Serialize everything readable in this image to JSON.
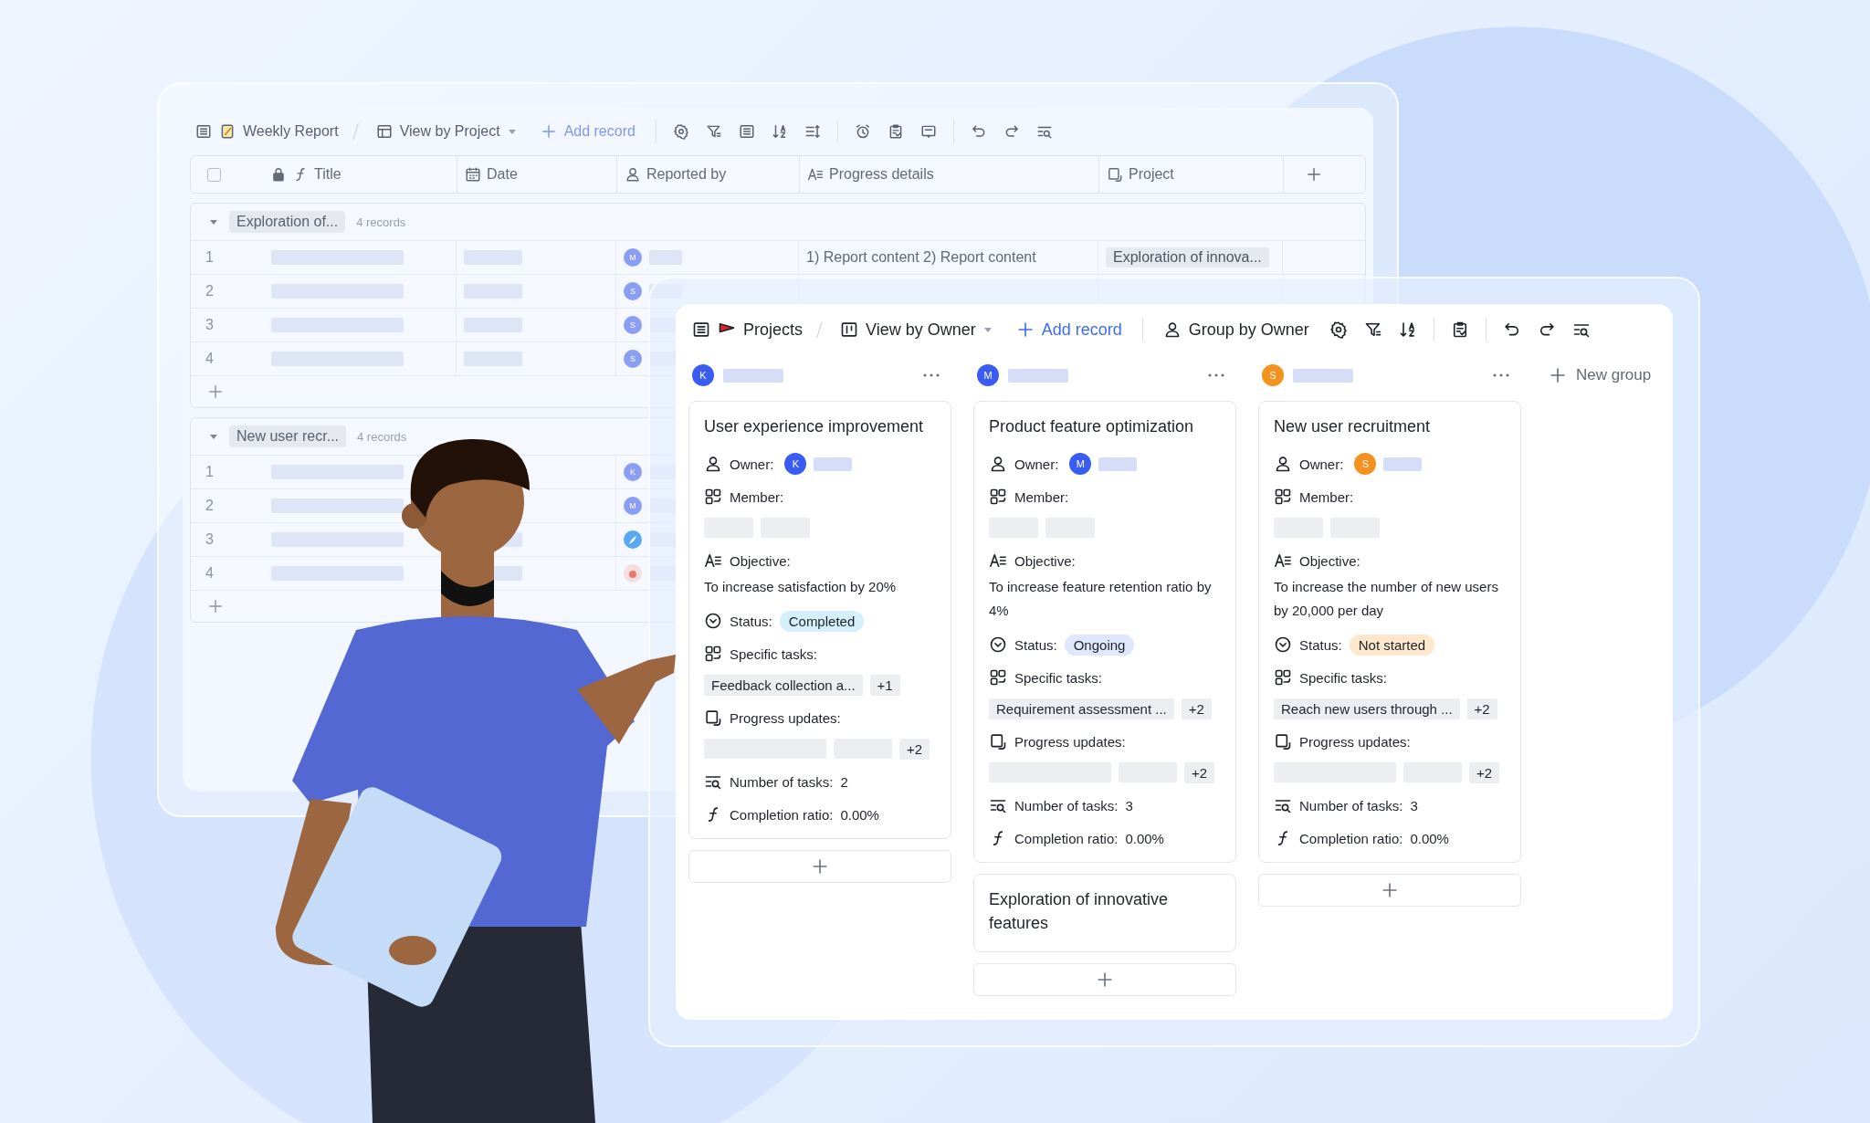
{
  "back_window": {
    "toolbar": {
      "title": "Weekly Report",
      "view": "View by Project",
      "add_record": "Add record"
    },
    "select_all": {
      "checked": false
    },
    "columns": [
      {
        "kind": "formula",
        "label": "Title"
      },
      {
        "kind": "date",
        "label": "Date"
      },
      {
        "kind": "person",
        "label": "Reported by"
      },
      {
        "kind": "text",
        "label": "Progress details"
      },
      {
        "kind": "link",
        "label": "Project"
      }
    ],
    "groups": [
      {
        "label": "Exploration of...",
        "count": "4 records",
        "expanded": true,
        "rows": [
          {
            "number": "1",
            "avatar": {
              "kind": "letter",
              "text": "M"
            },
            "progress": "1) Report content 2) Report content",
            "project": "Exploration of innova..."
          },
          {
            "number": "2",
            "avatar": {
              "kind": "letter",
              "text": "S"
            }
          },
          {
            "number": "3",
            "avatar": {
              "kind": "letter",
              "text": "S"
            }
          },
          {
            "number": "4",
            "avatar": {
              "kind": "letter",
              "text": "S"
            }
          }
        ]
      },
      {
        "label": "New user recr...",
        "count": "4 records",
        "expanded": true,
        "rows": [
          {
            "number": "1",
            "avatar": {
              "kind": "letter",
              "text": "K"
            }
          },
          {
            "number": "2",
            "avatar": {
              "kind": "letter",
              "text": "M"
            }
          },
          {
            "number": "3",
            "avatar": {
              "kind": "feather"
            }
          },
          {
            "number": "4",
            "avatar": {
              "kind": "fruit"
            }
          }
        ]
      }
    ]
  },
  "front_window": {
    "toolbar": {
      "title": "Projects",
      "view": "View by Owner",
      "add_record": "Add record",
      "group_by": "Group by Owner"
    },
    "columns": [
      {
        "avatar": "K",
        "color": "#3b5cf2",
        "cards": [
          {
            "title": "User experience improvement",
            "fields": [
              {
                "kind": "owner",
                "label": "Owner:",
                "avatar": "K",
                "color": "#3b5cf2"
              },
              {
                "kind": "member",
                "label": "Member:"
              },
              {
                "kind": "objective",
                "label": "Objective:",
                "value": "To increase satisfaction by 20%"
              },
              {
                "kind": "status",
                "label": "Status:",
                "value": "Completed",
                "color": "#d5f0fb"
              },
              {
                "kind": "tasks",
                "label": "Specific tasks:",
                "value": "Feedback collection a...",
                "more": "+1"
              },
              {
                "kind": "progress",
                "label": "Progress updates:",
                "more": "+2"
              },
              {
                "kind": "count",
                "label": "Number of tasks:",
                "value": "2"
              },
              {
                "kind": "formula",
                "label": "Completion ratio:",
                "value": "0.00%"
              }
            ]
          }
        ]
      },
      {
        "avatar": "M",
        "color": "#3b5cf2",
        "cards": [
          {
            "title": "Product feature optimization",
            "fields": [
              {
                "kind": "owner",
                "label": "Owner:",
                "avatar": "M",
                "color": "#3b5cf2"
              },
              {
                "kind": "member",
                "label": "Member:"
              },
              {
                "kind": "objective",
                "label": "Objective:",
                "value": "To increase feature retention ratio by 4%"
              },
              {
                "kind": "status",
                "label": "Status:",
                "value": "Ongoing",
                "color": "#dfe7fd"
              },
              {
                "kind": "tasks",
                "label": "Specific tasks:",
                "value": "Requirement assessment ...",
                "more": "+2"
              },
              {
                "kind": "progress",
                "label": "Progress updates:",
                "more": "+2"
              },
              {
                "kind": "count",
                "label": "Number of tasks:",
                "value": "3"
              },
              {
                "kind": "formula",
                "label": "Completion ratio:",
                "value": "0.00%"
              }
            ]
          },
          {
            "title": "Exploration of innovative features"
          }
        ]
      },
      {
        "avatar": "S",
        "color": "#f4921f",
        "cards": [
          {
            "title": "New user recruitment",
            "fields": [
              {
                "kind": "owner",
                "label": "Owner:",
                "avatar": "S",
                "color": "#f4921f"
              },
              {
                "kind": "member",
                "label": "Member:"
              },
              {
                "kind": "objective",
                "label": "Objective:",
                "value": "To increase the number of new users by 20,000 per day"
              },
              {
                "kind": "status",
                "label": "Status:",
                "value": "Not started",
                "color": "#fde8cd"
              },
              {
                "kind": "tasks",
                "label": "Specific tasks:",
                "value": "Reach new users through ...",
                "more": "+2"
              },
              {
                "kind": "progress",
                "label": "Progress updates:",
                "more": "+2"
              },
              {
                "kind": "count",
                "label": "Number of tasks:",
                "value": "3"
              },
              {
                "kind": "formula",
                "label": "Completion ratio:",
                "value": "0.00%"
              }
            ]
          }
        ]
      }
    ],
    "new_group": "New group"
  }
}
